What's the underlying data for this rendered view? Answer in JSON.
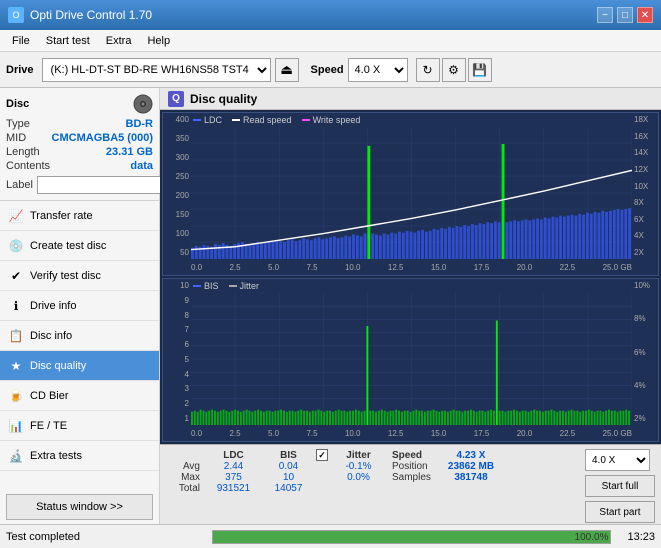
{
  "app": {
    "title": "Opti Drive Control 1.70",
    "icon": "O"
  },
  "titlebar": {
    "minimize": "−",
    "maximize": "□",
    "close": "✕"
  },
  "menu": {
    "items": [
      "File",
      "Start test",
      "Extra",
      "Help"
    ]
  },
  "toolbar": {
    "drive_label": "Drive",
    "drive_value": "(K:) HL-DT-ST BD-RE WH16NS58 TST4",
    "speed_label": "Speed",
    "speed_value": "4.0 X"
  },
  "disc": {
    "title": "Disc",
    "type_label": "Type",
    "type_value": "BD-R",
    "mid_label": "MID",
    "mid_value": "CMCMAGBA5 (000)",
    "length_label": "Length",
    "length_value": "23.31 GB",
    "contents_label": "Contents",
    "contents_value": "data",
    "label_label": "Label"
  },
  "nav": {
    "items": [
      {
        "id": "transfer-rate",
        "label": "Transfer rate",
        "icon": "📈"
      },
      {
        "id": "create-test-disc",
        "label": "Create test disc",
        "icon": "💿"
      },
      {
        "id": "verify-test-disc",
        "label": "Verify test disc",
        "icon": "✔"
      },
      {
        "id": "drive-info",
        "label": "Drive info",
        "icon": "ℹ"
      },
      {
        "id": "disc-info",
        "label": "Disc info",
        "icon": "📋"
      },
      {
        "id": "disc-quality",
        "label": "Disc quality",
        "icon": "★",
        "active": true
      },
      {
        "id": "cd-bier",
        "label": "CD Bier",
        "icon": "🍺"
      },
      {
        "id": "fe-te",
        "label": "FE / TE",
        "icon": "📊"
      },
      {
        "id": "extra-tests",
        "label": "Extra tests",
        "icon": "🔬"
      }
    ],
    "status_btn": "Status window >>"
  },
  "disc_quality": {
    "title": "Disc quality",
    "upper_chart": {
      "legend": [
        {
          "label": "LDC",
          "color": "#4444ff"
        },
        {
          "label": "Read speed",
          "color": "#ffffff"
        },
        {
          "label": "Write speed",
          "color": "#ff44ff"
        }
      ],
      "y_axis": [
        "400",
        "350",
        "300",
        "250",
        "200",
        "150",
        "100",
        "50"
      ],
      "y_axis_right": [
        "18X",
        "16X",
        "14X",
        "12X",
        "10X",
        "8X",
        "6X",
        "4X",
        "2X"
      ],
      "x_axis": [
        "0.0",
        "2.5",
        "5.0",
        "7.5",
        "10.0",
        "12.5",
        "15.0",
        "17.5",
        "20.0",
        "22.5",
        "25.0 GB"
      ]
    },
    "lower_chart": {
      "legend": [
        {
          "label": "BIS",
          "color": "#4444ff"
        },
        {
          "label": "Jitter",
          "color": "#aaaaaa"
        }
      ],
      "y_axis": [
        "10",
        "9",
        "8",
        "7",
        "6",
        "5",
        "4",
        "3",
        "2",
        "1"
      ],
      "y_axis_right": [
        "10%",
        "8%",
        "6%",
        "4%",
        "2%"
      ],
      "x_axis": [
        "0.0",
        "2.5",
        "5.0",
        "7.5",
        "10.0",
        "12.5",
        "15.0",
        "17.5",
        "20.0",
        "22.5",
        "25.0 GB"
      ]
    }
  },
  "stats": {
    "headers": [
      "LDC",
      "BIS"
    ],
    "jitter_label": "Jitter",
    "jitter_checked": true,
    "speed_label": "Speed",
    "speed_value": "4.23 X",
    "speed_select": "4.0 X",
    "rows": [
      {
        "label": "Avg",
        "ldc": "2.44",
        "bis": "0.04",
        "jitter": "-0.1%"
      },
      {
        "label": "Max",
        "ldc": "375",
        "bis": "10",
        "jitter": "0.0%"
      },
      {
        "label": "Total",
        "ldc": "931521",
        "bis": "14057",
        "jitter": ""
      }
    ],
    "position_label": "Position",
    "position_value": "23862 MB",
    "samples_label": "Samples",
    "samples_value": "381748",
    "start_full": "Start full",
    "start_part": "Start part"
  },
  "statusbar": {
    "text": "Test completed",
    "progress": 100.0,
    "progress_display": "100.0%",
    "time": "13:23"
  }
}
